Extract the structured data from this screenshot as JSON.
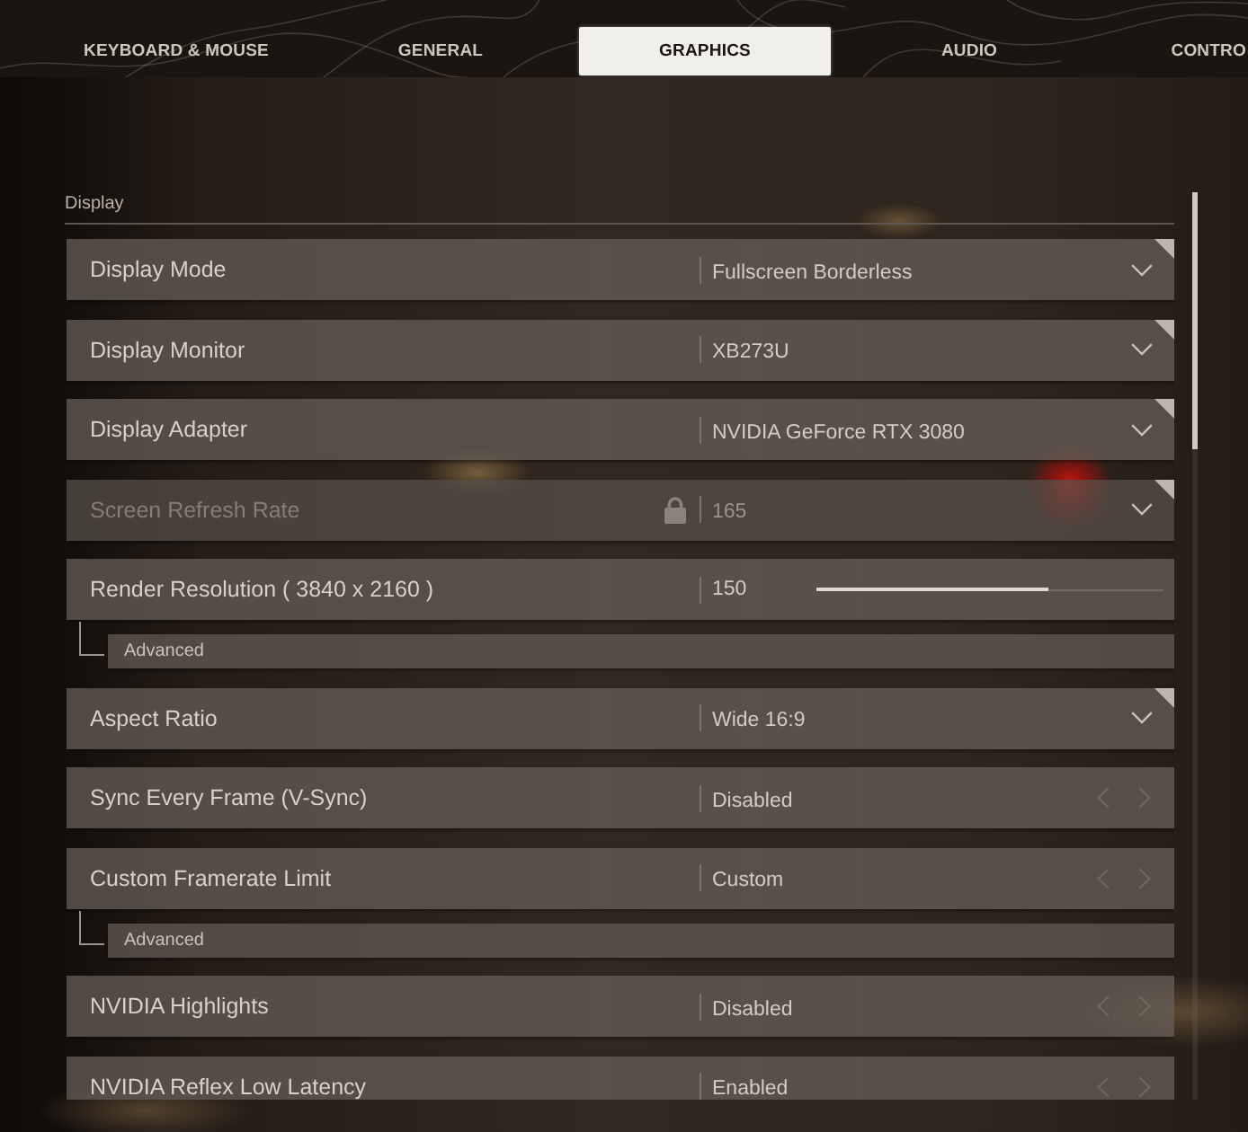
{
  "tabs": [
    {
      "label": "KEYBOARD & MOUSE",
      "selected": false
    },
    {
      "label": "GENERAL",
      "selected": false
    },
    {
      "label": "GRAPHICS",
      "selected": true
    },
    {
      "label": "AUDIO",
      "selected": false
    },
    {
      "label": "CONTRO",
      "selected": false
    }
  ],
  "section": {
    "title": "Display"
  },
  "settings": [
    {
      "kind": "dropdown",
      "label": "Display Mode",
      "value": "Fullscreen Borderless",
      "disabled": false
    },
    {
      "kind": "dropdown",
      "label": "Display Monitor",
      "value": "XB273U",
      "disabled": false
    },
    {
      "kind": "dropdown",
      "label": "Display Adapter",
      "value": "NVIDIA GeForce RTX 3080",
      "disabled": false
    },
    {
      "kind": "dropdown",
      "label": "Screen Refresh Rate",
      "value": "165",
      "disabled": true
    },
    {
      "kind": "slider",
      "label": "Render Resolution ( 3840 x 2160 )",
      "value": "150",
      "level": 0.667,
      "disabled": false,
      "children": [
        {
          "label": "Advanced"
        }
      ]
    },
    {
      "kind": "dropdown",
      "label": "Aspect Ratio",
      "value": "Wide 16:9",
      "disabled": false
    },
    {
      "kind": "toggle",
      "label": "Sync Every Frame (V-Sync)",
      "value": "Disabled",
      "disabled": false
    },
    {
      "kind": "toggle",
      "label": "Custom Framerate Limit",
      "value": "Custom",
      "disabled": false,
      "children": [
        {
          "label": "Advanced"
        }
      ]
    },
    {
      "kind": "toggle",
      "label": "NVIDIA Highlights",
      "value": "Disabled",
      "disabled": false
    },
    {
      "kind": "toggle",
      "label": "NVIDIA Reflex Low Latency",
      "value": "Enabled",
      "disabled": false
    }
  ]
}
